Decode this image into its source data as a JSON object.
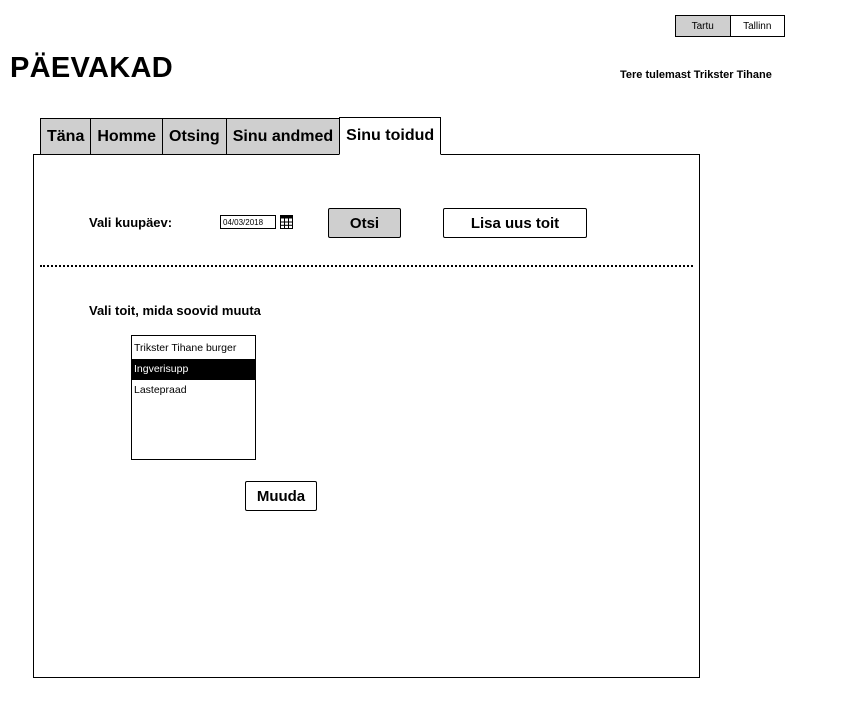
{
  "city_toggle": {
    "options": [
      "Tartu",
      "Tallinn"
    ],
    "selected": "Tartu"
  },
  "app_title": "PÄEVAKAD",
  "welcome": "Tere tulemast Trikster Tihane",
  "tabs": [
    {
      "label": "Täna",
      "active": false
    },
    {
      "label": "Homme",
      "active": false
    },
    {
      "label": "Otsing",
      "active": false
    },
    {
      "label": "Sinu andmed",
      "active": false
    },
    {
      "label": "Sinu toidud",
      "active": true
    }
  ],
  "date_section": {
    "label": "Vali kuupäev:",
    "date_value": "04/03/2018",
    "search_label": "Otsi",
    "add_label": "Lisa uus toit"
  },
  "food_section": {
    "label": "Vali toit, mida soovid muuta",
    "items": [
      "Trikster Tihane burger",
      "Ingverisupp",
      "Lastepraad"
    ],
    "selected": "Ingverisupp",
    "change_label": "Muuda"
  },
  "colors": {
    "tab_inactive": "#cfcfcf",
    "selected_bg": "#000000",
    "selected_fg": "#ffffff"
  }
}
